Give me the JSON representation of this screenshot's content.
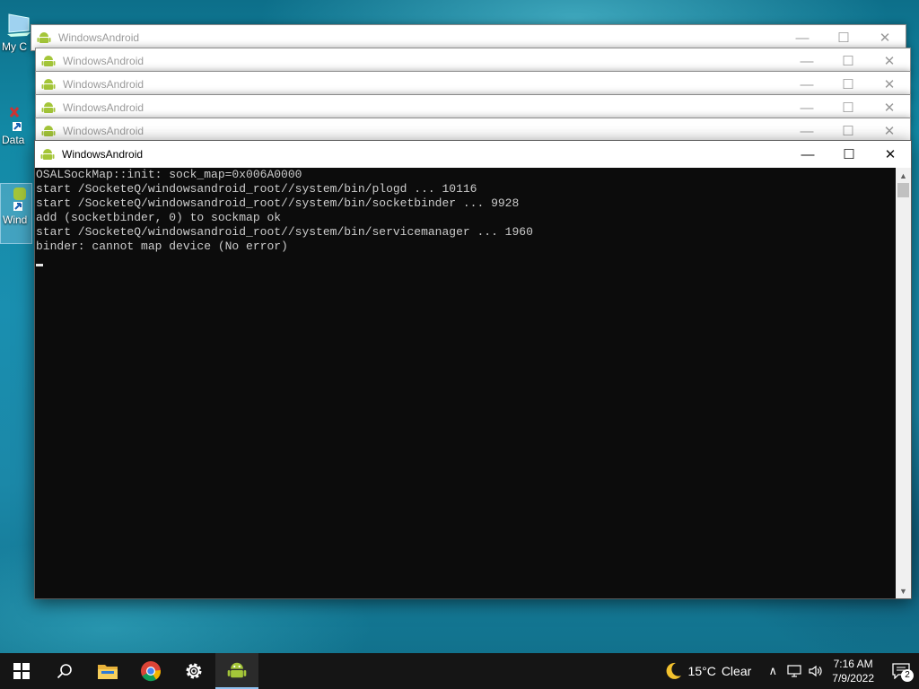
{
  "desktop": {
    "icons": [
      {
        "label": "My C",
        "icon": "computer-icon"
      },
      {
        "label": "Data",
        "icon": "database-shortcut-icon"
      },
      {
        "label": "Wind",
        "icon": "windowsandroid-shortcut-icon"
      }
    ]
  },
  "windows": [
    {
      "title": "WindowsAndroid",
      "active": false
    },
    {
      "title": "WindowsAndroid",
      "active": false
    },
    {
      "title": "WindowsAndroid",
      "active": false
    },
    {
      "title": "WindowsAndroid",
      "active": false
    },
    {
      "title": "WindowsAndroid",
      "active": false
    },
    {
      "title": "WindowsAndroid",
      "active": true
    }
  ],
  "window_controls": {
    "minimize": "—",
    "maximize": "☐",
    "close": "✕"
  },
  "console": {
    "lines": [
      "OSALSockMap::init: sock_map=0x006A0000",
      "start /SocketeQ/windowsandroid_root//system/bin/plogd ... 10116",
      "start /SocketeQ/windowsandroid_root//system/bin/socketbinder ... 9928",
      "add (socketbinder, 0) to sockmap ok",
      "start /SocketeQ/windowsandroid_root//system/bin/servicemanager ... 1960",
      "binder: cannot map device (No error)"
    ]
  },
  "taskbar": {
    "apps": [
      {
        "name": "start-button",
        "icon": "windows-logo-icon"
      },
      {
        "name": "search-button",
        "icon": "search-icon"
      },
      {
        "name": "file-explorer",
        "icon": "folder-icon"
      },
      {
        "name": "chrome",
        "icon": "chrome-icon"
      },
      {
        "name": "settings",
        "icon": "gear-icon"
      },
      {
        "name": "windowsandroid",
        "icon": "android-icon",
        "running": true
      }
    ],
    "weather": {
      "temp": "15°C",
      "condition": "Clear",
      "icon": "moon-icon"
    },
    "clock": {
      "time": "7:16 AM",
      "date": "7/9/2022"
    },
    "notifications": {
      "count": "2"
    }
  },
  "colors": {
    "console_bg": "#0c0c0c",
    "console_text": "#cccccc",
    "android_green": "#a4c639",
    "taskbar": "#151515"
  }
}
